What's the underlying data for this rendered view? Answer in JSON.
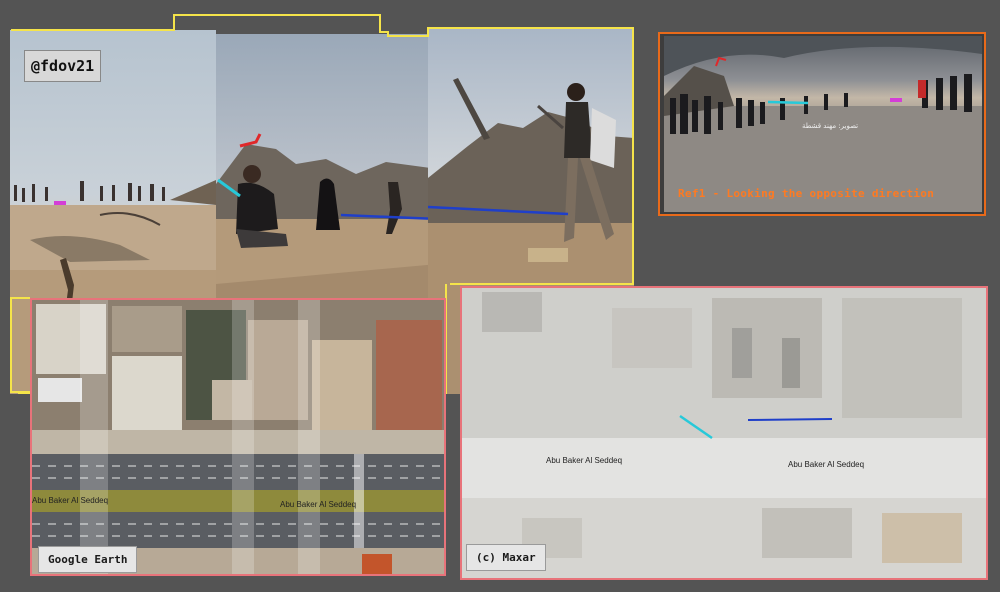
{
  "watermark": {
    "handle": "@fdov21"
  },
  "ref_panel": {
    "caption": "Ref1 - Looking the opposite direction",
    "arabic_credit": "تصوير: مهند قشطة"
  },
  "google_earth": {
    "badge": "Google Earth",
    "road_label_left": "Abu Baker Al Seddeq",
    "road_label_center": "Abu Baker Al Seddeq"
  },
  "maxar": {
    "badge": "(c) Maxar",
    "road_label_left": "Abu Baker Al Seddeq",
    "road_label_right": "Abu Baker Al Seddeq"
  },
  "colors": {
    "panorama_outline": "#f5e44a",
    "ref_outline": "#e96a1a",
    "satellite_outline": "#e8737a",
    "marker_red": "#e0282a",
    "marker_cyan": "#27c9d9",
    "marker_blue": "#1f3fc9",
    "marker_magenta": "#d43ed7"
  }
}
